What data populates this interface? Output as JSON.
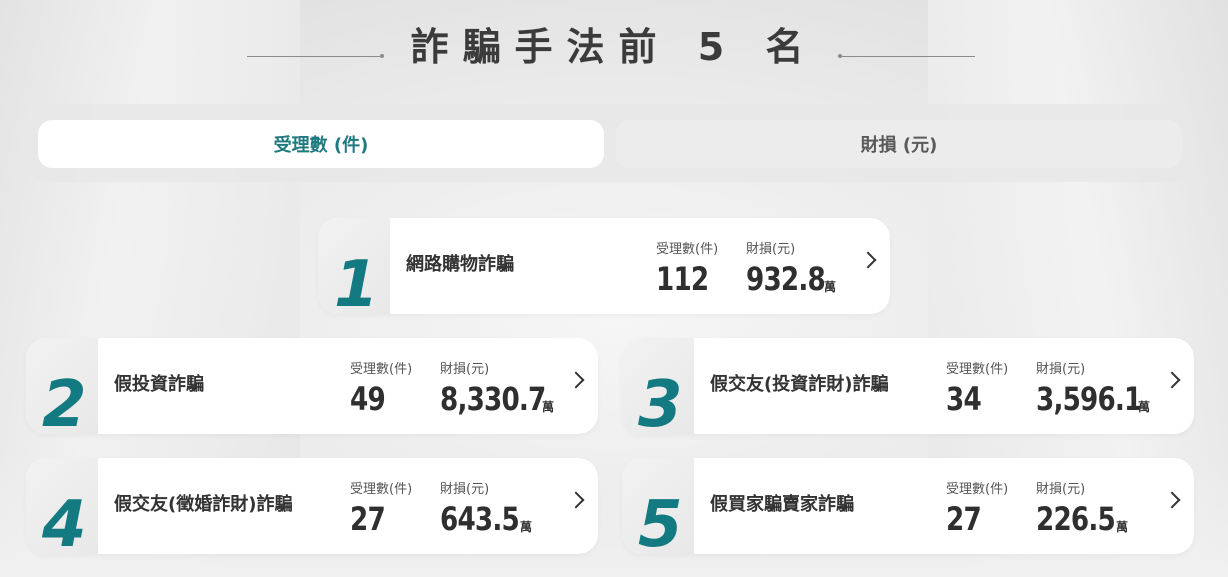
{
  "title": "詐騙手法前 5 名",
  "tabs": [
    {
      "label": "受理數 (件)",
      "active": true
    },
    {
      "label": "財損 (元)",
      "active": false
    }
  ],
  "colors": {
    "accent": "#147a82",
    "tab_active_text": "#1f7a80"
  },
  "cases_label": "受理數(件)",
  "loss_label": "財損(元)",
  "loss_unit": "萬",
  "ranking": [
    {
      "rank": "1",
      "name": "網路購物詐騙",
      "cases": "112",
      "loss": "932.8"
    },
    {
      "rank": "2",
      "name": "假投資詐騙",
      "cases": "49",
      "loss": "8,330.7"
    },
    {
      "rank": "3",
      "name": "假交友(投資詐財)詐騙",
      "cases": "34",
      "loss": "3,596.1"
    },
    {
      "rank": "4",
      "name": "假交友(徵婚詐財)詐騙",
      "cases": "27",
      "loss": "643.5"
    },
    {
      "rank": "5",
      "name": "假買家騙賣家詐騙",
      "cases": "27",
      "loss": "226.5"
    }
  ]
}
